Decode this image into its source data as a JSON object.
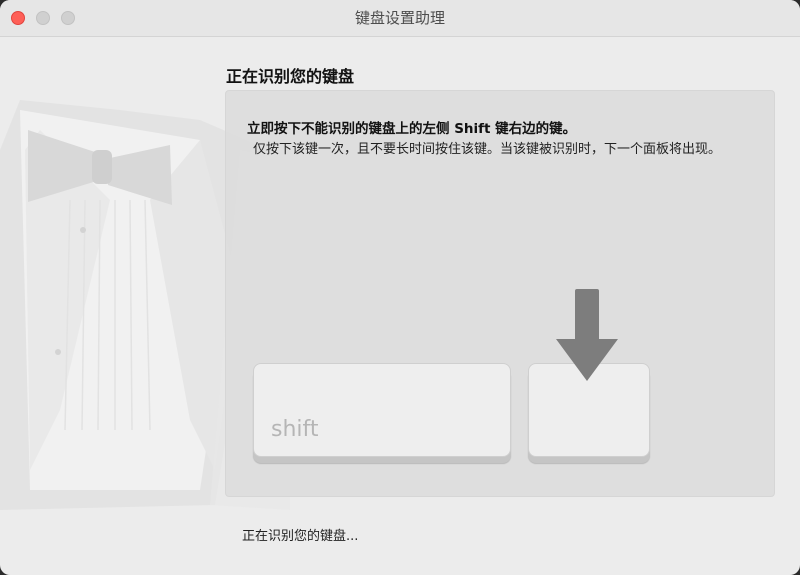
{
  "window": {
    "title": "键盘设置助理"
  },
  "main": {
    "heading": "正在识别您的键盘",
    "instruction": "立即按下不能识别的键盘上的左侧 Shift 键右边的键。",
    "detail": "仅按下该键一次，且不要长时间按住该键。当该键被识别时，下一个面板将出现。"
  },
  "keys": {
    "shift_label": "shift",
    "target_label": ""
  },
  "icons": {
    "arrow": "down-arrow-icon",
    "illustration": "tuxedo-illustration"
  },
  "status": {
    "text": "正在识别您的键盘..."
  },
  "colors": {
    "close": "#fe5f57",
    "arrow": "#7d7d7d"
  }
}
